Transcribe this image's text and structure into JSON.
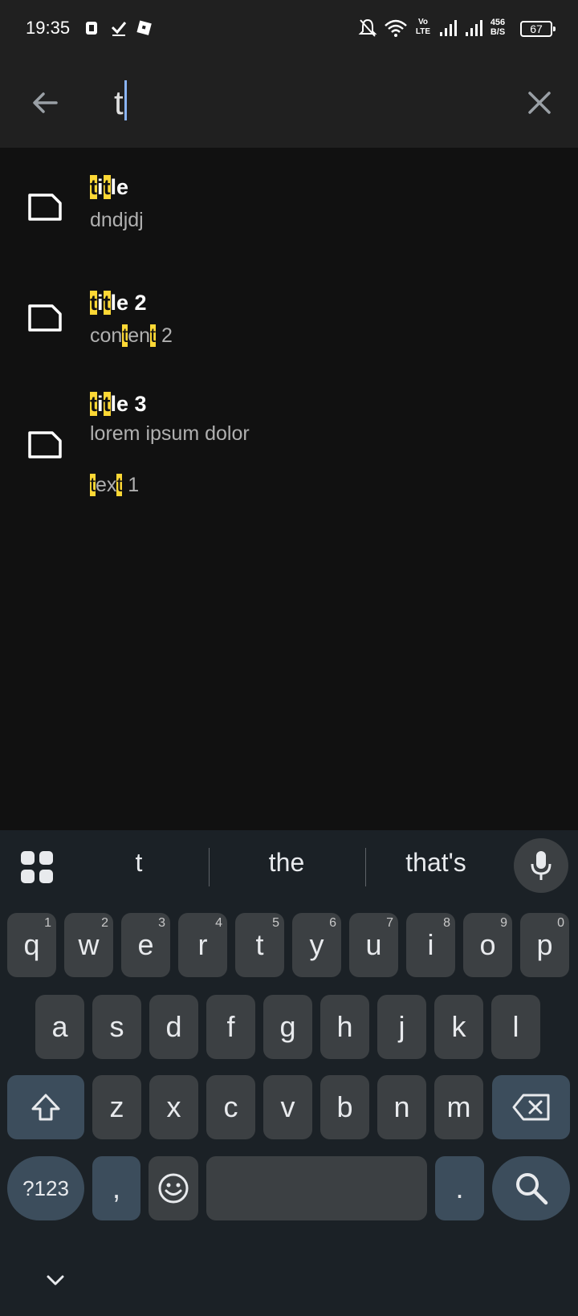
{
  "status_bar": {
    "time": "19:35",
    "volte_label": "Vo\nLTE",
    "speed_value": "456",
    "speed_unit": "B/S",
    "battery": "67"
  },
  "search": {
    "value": "t",
    "back_icon": "arrow-left-icon",
    "clear_icon": "close-icon"
  },
  "results": [
    {
      "title_parts": [
        {
          "t": "t",
          "h": true
        },
        {
          "t": "i",
          "h": false
        },
        {
          "t": "t",
          "h": true
        },
        {
          "t": "le",
          "h": false
        }
      ],
      "body_lines": [
        [
          {
            "t": "dndjdj",
            "h": false
          }
        ]
      ]
    },
    {
      "title_parts": [
        {
          "t": "t",
          "h": true
        },
        {
          "t": "i",
          "h": false
        },
        {
          "t": "t",
          "h": true
        },
        {
          "t": "le 2",
          "h": false
        }
      ],
      "body_lines": [
        [
          {
            "t": "con",
            "h": false
          },
          {
            "t": "t",
            "h": true
          },
          {
            "t": "en",
            "h": false
          },
          {
            "t": "t",
            "h": true
          },
          {
            "t": " 2",
            "h": false
          }
        ]
      ]
    },
    {
      "title_parts": [
        {
          "t": "t",
          "h": true
        },
        {
          "t": "i",
          "h": false
        },
        {
          "t": "t",
          "h": true
        },
        {
          "t": "le 3",
          "h": false
        }
      ],
      "body_lines": [
        [
          {
            "t": "lorem ipsum dolor",
            "h": false
          }
        ],
        [
          {
            "t": "t",
            "h": true
          },
          {
            "t": "ex",
            "h": false
          },
          {
            "t": "t",
            "h": true
          },
          {
            "t": " 1",
            "h": false
          }
        ]
      ]
    }
  ],
  "keyboard": {
    "suggestions": [
      "t",
      "the",
      "that's"
    ],
    "row1": [
      {
        "k": "q",
        "n": "1"
      },
      {
        "k": "w",
        "n": "2"
      },
      {
        "k": "e",
        "n": "3"
      },
      {
        "k": "r",
        "n": "4"
      },
      {
        "k": "t",
        "n": "5"
      },
      {
        "k": "y",
        "n": "6"
      },
      {
        "k": "u",
        "n": "7"
      },
      {
        "k": "i",
        "n": "8"
      },
      {
        "k": "o",
        "n": "9"
      },
      {
        "k": "p",
        "n": "0"
      }
    ],
    "row2": [
      "a",
      "s",
      "d",
      "f",
      "g",
      "h",
      "j",
      "k",
      "l"
    ],
    "row3": [
      "z",
      "x",
      "c",
      "v",
      "b",
      "n",
      "m"
    ],
    "symbols_label": "?123",
    "comma": ",",
    "period": "."
  },
  "colors": {
    "highlight": "#fdd835",
    "keyboard_bg": "#1b2126",
    "key_bg": "#3c4043",
    "accent_key_bg": "#3c4d5c",
    "caret": "#8ab4f8"
  }
}
